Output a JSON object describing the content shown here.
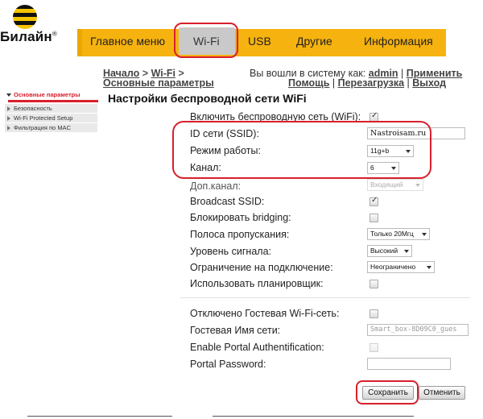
{
  "brand": {
    "name": "Билайн",
    "reg": "®"
  },
  "menu": {
    "items": [
      {
        "id": "main",
        "label": "Главное меню"
      },
      {
        "id": "wifi",
        "label": "Wi-Fi"
      },
      {
        "id": "usb",
        "label": "USB"
      },
      {
        "id": "other",
        "label": "Другие"
      },
      {
        "id": "info",
        "label": "Информация"
      }
    ],
    "active": "Wi-Fi"
  },
  "breadcrumb": {
    "home": "Начало",
    "wifi": "Wi-Fi",
    "current": "Основные параметры"
  },
  "header": {
    "logged_in_text": "Вы вошли в систему как:",
    "user": "admin",
    "apply": "Применить",
    "help": "Помощь",
    "reboot": "Перезагрузка",
    "logout": "Выход"
  },
  "page_title": "Настройки беспроводной сети WiFi",
  "sidebar": {
    "items": [
      {
        "label": "Основные параметры",
        "active": true
      },
      {
        "label": "Безопасность",
        "active": false
      },
      {
        "label": "Wi-Fi Protected Setup",
        "active": false
      },
      {
        "label": "Фильтрация по MAC",
        "active": false
      }
    ]
  },
  "form": {
    "enable_wifi": {
      "label": "Включить беспроводную сеть (WiFi):",
      "checked": true
    },
    "ssid": {
      "label": "ID сети (SSID):",
      "value": "Nastroisam.ru"
    },
    "mode": {
      "label": "Режим работы:",
      "value": "11g+b"
    },
    "channel": {
      "label": "Канал:",
      "value": "6"
    },
    "ext_channel": {
      "label": "Доп.канал:",
      "value": "Входящий"
    },
    "broadcast_ssid": {
      "label": "Broadcast SSID:",
      "checked": true
    },
    "block_bridging": {
      "label": "Блокировать bridging:",
      "checked": false
    },
    "bandwidth": {
      "label": "Полоса пропускания:",
      "value": "Только 20Мгц"
    },
    "signal_level": {
      "label": "Уровень сигнала:",
      "value": "Высокий"
    },
    "conn_limit": {
      "label": "Ограничение на подключение:",
      "value": "Неограничено"
    },
    "scheduler": {
      "label": "Использовать планировщик:",
      "checked": false
    },
    "guest_disabled": {
      "label": "Отключено Гостевая Wi-Fi-сеть:",
      "checked": false
    },
    "guest_ssid": {
      "label": "Гостевая Имя сети:",
      "value": "Smart_box-8D09C0_gues"
    },
    "portal_auth": {
      "label": "Enable Portal Authentification:",
      "checked": false
    },
    "portal_password": {
      "label": "Portal Password:",
      "value": ""
    }
  },
  "buttons": {
    "save": "Сохранить",
    "cancel": "Отменить"
  },
  "colors": {
    "accent": "#f6b20f",
    "highlight": "#d8202d",
    "active_tab": "#c9c9c9"
  }
}
